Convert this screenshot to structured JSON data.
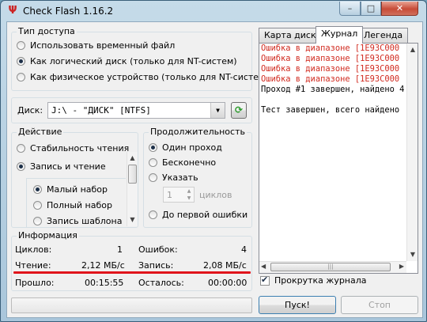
{
  "window": {
    "title": "Check Flash 1.16.2",
    "minimize": "–",
    "maximize": "□",
    "close": "✕"
  },
  "access": {
    "title": "Тип доступа",
    "options": [
      "Использовать временный файл",
      "Как логический диск (только для NT-систем)",
      "Как физическое устройство (только для NT-систем)"
    ],
    "selected": 1
  },
  "disk": {
    "label": "Диск:",
    "value": "J:\\ - \"ДИСК\" [NTFS]",
    "refresh_icon": "refresh-icon"
  },
  "action": {
    "title": "Действие",
    "options": [
      "Стабильность чтения",
      "Запись и чтение"
    ],
    "selected": 1,
    "sub_options": [
      "Малый набор",
      "Полный набор",
      "Запись шаблона"
    ],
    "sub_selected": 0
  },
  "duration": {
    "title": "Продолжительность",
    "options": [
      "Один проход",
      "Бесконечно",
      "Указать",
      "До первой ошибки"
    ],
    "selected": 0,
    "cycles_value": "1",
    "cycles_label": "циклов"
  },
  "info": {
    "title": "Информация",
    "cycles_label": "Циклов:",
    "cycles_value": "1",
    "errors_label": "Ошибок:",
    "errors_value": "4",
    "read_label": "Чтение:",
    "read_value": "2,12 МБ/с",
    "write_label": "Запись:",
    "write_value": "2,08 МБ/с",
    "elapsed_label": "Прошло:",
    "elapsed_value": "00:15:55",
    "remaining_label": "Осталось:",
    "remaining_value": "00:00:00"
  },
  "tabs": [
    "Карта диска",
    "Журнал",
    "Легенда"
  ],
  "active_tab": 1,
  "log": [
    {
      "text": "Ошибка в диапазоне [1E93C000",
      "type": "error"
    },
    {
      "text": "Ошибка в диапазоне [1E93C000",
      "type": "error"
    },
    {
      "text": "Ошибка в диапазоне [1E93C000",
      "type": "error"
    },
    {
      "text": "Ошибка в диапазоне [1E93C000",
      "type": "error"
    },
    {
      "text": "Проход #1 завершен, найдено 4",
      "type": "normal"
    },
    {
      "text": "",
      "type": "normal"
    },
    {
      "text": "Тест завершен, всего найдено",
      "type": "normal"
    }
  ],
  "scroll_log": {
    "label": "Прокрутка журнала",
    "checked": true
  },
  "buttons": {
    "start": "Пуск!",
    "stop": "Стоп"
  },
  "colors": {
    "error_text": "#d12a1f",
    "annotation_line": "#e0141b"
  }
}
